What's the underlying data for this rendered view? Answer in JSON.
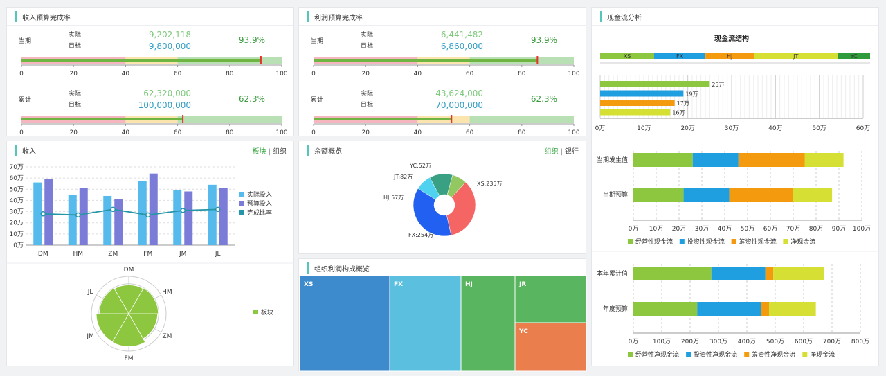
{
  "panels": {
    "revenue_budget": {
      "title": "收入预算完成率",
      "rows": [
        {
          "label": "当期",
          "actual_label": "实际",
          "target_label": "目标",
          "actual": "9,202,118",
          "target": "9,800,000",
          "rate": "93.9%",
          "value": 92
        },
        {
          "label": "累计",
          "actual_label": "实际",
          "target_label": "目标",
          "actual": "62,320,000",
          "target": "100,000,000",
          "rate": "62.3%",
          "value": 62
        }
      ]
    },
    "profit_budget": {
      "title": "利润预算完成率",
      "rows": [
        {
          "label": "当期",
          "actual_label": "实际",
          "target_label": "目标",
          "actual": "6,441,482",
          "target": "6,860,000",
          "rate": "93.9%",
          "value": 86
        },
        {
          "label": "累计",
          "actual_label": "实际",
          "target_label": "目标",
          "actual": "43,624,000",
          "target": "70,000,000",
          "rate": "62.3%",
          "value": 53
        }
      ]
    },
    "cashflow": {
      "title": "现金流分析"
    },
    "income": {
      "title": "收入",
      "link_a": "板块",
      "link_sep": "|",
      "link_b": "组织"
    },
    "balance": {
      "title": "余额概览",
      "link_a": "组织",
      "link_sep": "|",
      "link_b": "银行"
    },
    "org_profit": {
      "title": "组织利润构成概览"
    }
  },
  "colors": {
    "green": "#8dc63f",
    "blue": "#1f9ee0",
    "orange": "#f39a0f",
    "yellow": "#d6df33",
    "dkgreen": "#2e9c3a",
    "purple": "#7b7bd8",
    "lightblue": "#56bbec",
    "teal": "#2596a8",
    "red": "#e8312a",
    "bullet_pink": "#f5b6bf",
    "bullet_yellow": "#fbe4ae",
    "bullet_green": "#b9dfb4"
  },
  "chart_data": [
    {
      "id": "bullet",
      "type": "bar",
      "ticks": [
        "0",
        "20",
        "40",
        "60",
        "80",
        "100"
      ],
      "xlim": [
        0,
        100
      ]
    },
    {
      "id": "cash-structure",
      "type": "bar",
      "title": "现金流结构",
      "categories": [
        "XS",
        "FX",
        "HJ",
        "JT",
        "YC"
      ],
      "values": [
        20,
        19,
        18,
        31,
        12
      ],
      "colors": [
        "#8dc63f",
        "#1f9ee0",
        "#f39a0f",
        "#d6df33",
        "#2e9c3a"
      ]
    },
    {
      "id": "cash-bars",
      "type": "bar",
      "values": [
        25,
        19,
        17,
        16
      ],
      "labels": [
        "25万",
        "19万",
        "17万",
        "16万"
      ],
      "colors": [
        "#8dc63f",
        "#1f9ee0",
        "#f39a0f",
        "#d6df33"
      ],
      "ticks": [
        "0万",
        "10万",
        "20万",
        "30万",
        "40万",
        "50万",
        "60万"
      ],
      "xlim": [
        0,
        60
      ]
    },
    {
      "id": "period-flow",
      "type": "bar",
      "categories": [
        "当期发生值",
        "当期预算"
      ],
      "series": [
        {
          "name": "经营性现金流",
          "values": [
            26,
            22
          ]
        },
        {
          "name": "投资性现金流",
          "values": [
            20,
            20
          ]
        },
        {
          "name": "筹资性现金流",
          "values": [
            29,
            28
          ]
        },
        {
          "name": "净现金流",
          "values": [
            17,
            17
          ]
        }
      ],
      "colors": [
        "#8dc63f",
        "#1f9ee0",
        "#f39a0f",
        "#d6df33"
      ],
      "ticks": [
        "0万",
        "10万",
        "20万",
        "30万",
        "40万",
        "50万",
        "60万",
        "70万",
        "80万",
        "90万",
        "100万"
      ],
      "xlim": [
        0,
        100
      ],
      "legend": "bottom"
    },
    {
      "id": "year-flow",
      "type": "bar",
      "categories": [
        "本年累计值",
        "年度预算"
      ],
      "series": [
        {
          "name": "经营性净现金流",
          "values": [
            275,
            225
          ]
        },
        {
          "name": "投资性净现金流",
          "values": [
            190,
            225
          ]
        },
        {
          "name": "筹资性净现金流",
          "values": [
            28,
            28
          ]
        },
        {
          "name": "净现金流",
          "values": [
            180,
            165
          ]
        }
      ],
      "colors": [
        "#8dc63f",
        "#1f9ee0",
        "#f39a0f",
        "#d6df33"
      ],
      "ticks": [
        "0万",
        "100万",
        "200万",
        "300万",
        "400万",
        "500万",
        "600万",
        "700万",
        "800万"
      ],
      "xlim": [
        0,
        800
      ],
      "legend": "bottom"
    },
    {
      "id": "income-combo",
      "type": "bar",
      "categories": [
        "DM",
        "HM",
        "ZM",
        "FM",
        "JM",
        "JL"
      ],
      "series": [
        {
          "name": "实际投入",
          "values": [
            56,
            45,
            44,
            57,
            49,
            54
          ]
        },
        {
          "name": "预算投入",
          "values": [
            59,
            51,
            41,
            64,
            48,
            51
          ]
        },
        {
          "name": "完成比率",
          "values": [
            28,
            27,
            32,
            27,
            31,
            32
          ]
        }
      ],
      "colors": [
        "#56bbec",
        "#7b7bd8",
        "#2596a8"
      ],
      "ticks": [
        "0万",
        "10万",
        "20万",
        "30万",
        "40万",
        "50万",
        "60万",
        "70万"
      ],
      "ylim": [
        0,
        70
      ],
      "legend": "right"
    },
    {
      "id": "radar",
      "type": "area",
      "categories": [
        "DM",
        "HM",
        "ZM",
        "FM",
        "JM",
        "JL"
      ],
      "series": [
        {
          "name": "板块",
          "values": [
            0.77,
            0.79,
            0.77,
            0.88,
            0.87,
            0.79
          ]
        }
      ],
      "color": "#8dc63f",
      "legend": "right"
    },
    {
      "id": "balance-donut",
      "type": "pie",
      "categories": [
        "XS",
        "FX",
        "HJ",
        "JT",
        "YC"
      ],
      "values": [
        235,
        254,
        57,
        82,
        52
      ],
      "labels": [
        "XS:235万",
        "FX:254万",
        "HJ:57万",
        "JT:82万",
        "YC:52万"
      ],
      "colors": [
        "#f46564",
        "#2160f0",
        "#4fd2f0",
        "#39a084",
        "#93c762"
      ]
    },
    {
      "id": "treemap",
      "type": "heatmap",
      "categories": [
        "XS",
        "FX",
        "HJ",
        "JR",
        "YC"
      ],
      "colors": [
        "#3d8bcc",
        "#5bc0df",
        "#59b55f",
        "#59b55f",
        "#ea7e4c"
      ]
    }
  ]
}
